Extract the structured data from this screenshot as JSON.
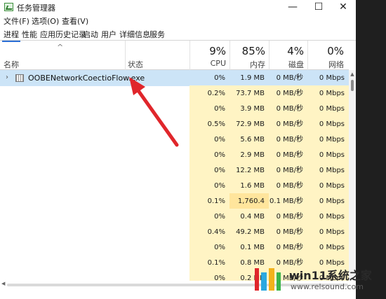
{
  "window": {
    "title": "任务管理器",
    "controls": {
      "minimize": "—",
      "maximize": "☐",
      "close": "✕"
    }
  },
  "menu": [
    "文件(F)",
    "选项(O)",
    "查看(V)"
  ],
  "tabs": [
    "进程",
    "性能",
    "应用历史记录",
    "启动",
    "用户",
    "详细信息",
    "服务"
  ],
  "header": {
    "sort_glyph": "^",
    "name_label": "名称",
    "status_label": "状态",
    "cpu": {
      "pct": "9%",
      "label": "CPU"
    },
    "memory": {
      "pct": "85%",
      "label": "内存"
    },
    "disk": {
      "pct": "4%",
      "label": "磁盘"
    },
    "network": {
      "pct": "0%",
      "label": "网络"
    }
  },
  "rows": [
    {
      "name": "OOBENetworkCoectioFlow.exe",
      "cpu": "0%",
      "mem": "1.9 MB",
      "disk": "0 MB/秒",
      "net": "0 Mbps",
      "selected": true
    },
    {
      "name": "",
      "cpu": "0.2%",
      "mem": "73.7 MB",
      "disk": "0 MB/秒",
      "net": "0 Mbps"
    },
    {
      "name": "",
      "cpu": "0%",
      "mem": "3.9 MB",
      "disk": "0 MB/秒",
      "net": "0 Mbps"
    },
    {
      "name": "",
      "cpu": "0.5%",
      "mem": "72.9 MB",
      "disk": "0 MB/秒",
      "net": "0 Mbps"
    },
    {
      "name": "",
      "cpu": "0%",
      "mem": "5.6 MB",
      "disk": "0 MB/秒",
      "net": "0 Mbps"
    },
    {
      "name": "",
      "cpu": "0%",
      "mem": "2.9 MB",
      "disk": "0 MB/秒",
      "net": "0 Mbps"
    },
    {
      "name": "",
      "cpu": "0%",
      "mem": "12.2 MB",
      "disk": "0 MB/秒",
      "net": "0 Mbps"
    },
    {
      "name": "",
      "cpu": "0%",
      "mem": "1.6 MB",
      "disk": "0 MB/秒",
      "net": "0 Mbps"
    },
    {
      "name": "",
      "cpu": "0.1%",
      "mem": "1,760.4 ...",
      "disk": "0.1 MB/秒",
      "net": "0 Mbps",
      "hot_mem": true
    },
    {
      "name": "",
      "cpu": "0%",
      "mem": "0.4 MB",
      "disk": "0 MB/秒",
      "net": "0 Mbps"
    },
    {
      "name": "",
      "cpu": "0.4%",
      "mem": "49.2 MB",
      "disk": "0 MB/秒",
      "net": "0 Mbps"
    },
    {
      "name": "",
      "cpu": "0%",
      "mem": "0.1 MB",
      "disk": "0 MB/秒",
      "net": "0 Mbps"
    },
    {
      "name": "",
      "cpu": "0.1%",
      "mem": "0.8 MB",
      "disk": "0 MB/秒",
      "net": "0 Mbps"
    },
    {
      "name": "",
      "cpu": "0%",
      "mem": "0.2 MB",
      "disk": "0 MB/秒",
      "net": "0 Mbps"
    }
  ],
  "watermark": {
    "title": "win11系统之家",
    "url": "www.relsound.com"
  },
  "colors": {
    "selected_row": "#cce4f7",
    "heat_light": "#fff4c4",
    "heat_strong": "#ffe59c",
    "arrow": "#e0262b",
    "tab_underline": "#2b6fd6"
  }
}
